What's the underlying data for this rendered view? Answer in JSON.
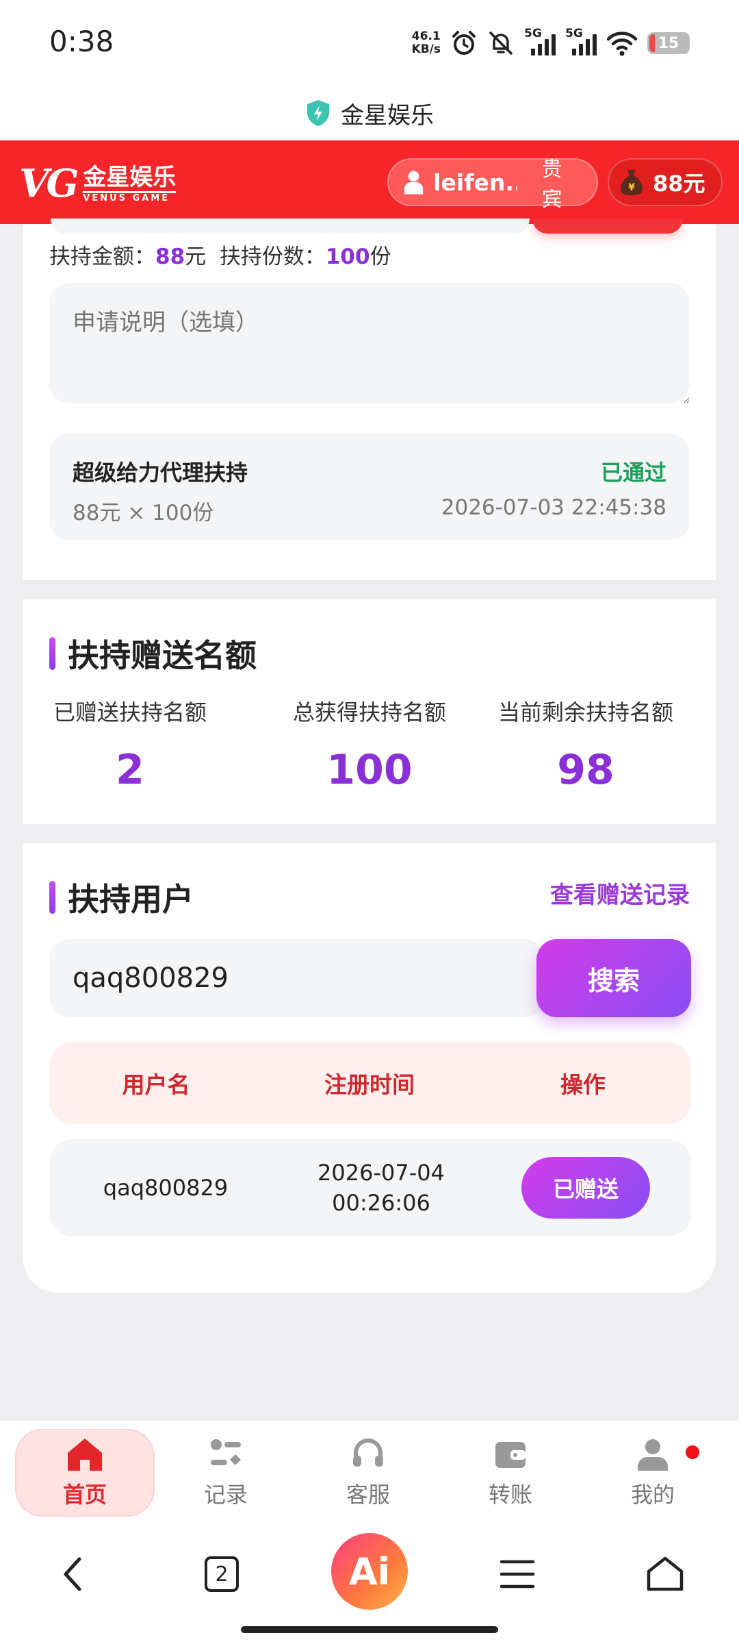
{
  "status_bar": {
    "time": "0:38",
    "speed_value": "46.1",
    "speed_unit": "KB/s",
    "network1": "5G",
    "network2": "5G",
    "battery": "15",
    "battery_fraction": 0.15
  },
  "browser": {
    "page_title": "金星娱乐",
    "tab_count": "2",
    "ai_label": "Ai"
  },
  "header": {
    "logo_mark": "VG",
    "logo_cn": "金星娱乐",
    "logo_en": "VENUS GAME",
    "username": "leifen...",
    "vip_label": "贵宾",
    "balance": "88元"
  },
  "apply": {
    "amount_label": "扶持金额：",
    "amount_value": "88",
    "amount_unit": "元",
    "copies_label": "扶持份数：",
    "copies_value": "100",
    "copies_unit": "份",
    "note_placeholder": "申请说明（选填）",
    "record": {
      "title": "超级给力代理扶持",
      "status": "已通过",
      "detail": "88元 × 100份",
      "time": "2026-07-03 22:45:38"
    }
  },
  "quota": {
    "title": "扶持赠送名额",
    "stats": [
      {
        "label": "已赠送扶持名额",
        "value": "2"
      },
      {
        "label": "总获得扶持名额",
        "value": "100"
      },
      {
        "label": "当前剩余扶持名额",
        "value": "98"
      }
    ]
  },
  "users": {
    "title": "扶持用户",
    "view_records": "查看赠送记录",
    "search_value": "qaq800829",
    "search_button": "搜索",
    "columns": [
      "用户名",
      "注册时间",
      "操作"
    ],
    "rows": [
      {
        "username": "qaq800829",
        "register_time": "2026-07-04 00:26:06",
        "action": "已赠送"
      }
    ]
  },
  "tabbar": {
    "items": [
      {
        "label": "首页",
        "icon": "home-icon",
        "active": true
      },
      {
        "label": "记录",
        "icon": "records-icon",
        "active": false
      },
      {
        "label": "客服",
        "icon": "headset-icon",
        "active": false
      },
      {
        "label": "转账",
        "icon": "wallet-icon",
        "active": false
      },
      {
        "label": "我的",
        "icon": "user-icon",
        "active": false
      }
    ]
  },
  "colors": {
    "brand_red": "#f5252a",
    "accent_purple": "#8b2fd6",
    "success_green": "#19a05a"
  }
}
